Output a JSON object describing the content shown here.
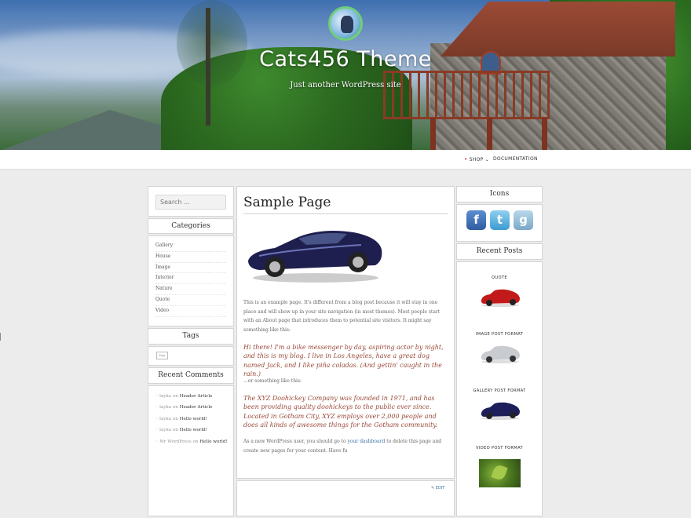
{
  "site": {
    "title": "Cats456 Theme",
    "tagline": "Just another WordPress site"
  },
  "nav": {
    "items": [
      {
        "label": "SHOP",
        "has_dropdown": true
      },
      {
        "label": "DOCUMENTATION",
        "has_dropdown": false
      }
    ]
  },
  "left_sidebar": {
    "search_placeholder": "Search ...",
    "categories_title": "Categories",
    "categories": [
      "Gallery",
      "House",
      "Image",
      "Interior",
      "Nature",
      "Quote",
      "Video"
    ],
    "tags_title": "Tags",
    "tag_chip": "Tags",
    "recent_comments_title": "Recent Comments",
    "comments": [
      {
        "author": "layka",
        "on": "on",
        "target": "Header Article"
      },
      {
        "author": "layka",
        "on": "on",
        "target": "Header Article"
      },
      {
        "author": "layka",
        "on": "on",
        "target": "Hello world!"
      },
      {
        "author": "layka",
        "on": "on",
        "target": "Hello world!"
      },
      {
        "author": "Mr WordPress",
        "on": "on",
        "target": "Hello world!"
      }
    ]
  },
  "main": {
    "page_title": "Sample Page",
    "para1": "This is an example page. It's different from a blog post because it will stay in one place and will show up in your site navigation (in most themes). Most people start with an About page that introduces them to potential site visitors. It might say something like this:",
    "quote1": "Hi there! I'm a bike messenger by day, aspiring actor by night, and this is my blog. I live in Los Angeles, have a great dog named Jack, and I like piña coladas. (And gettin' caught in the rain.)",
    "para2": "...or something like this:",
    "quote2": "The XYZ Doohickey Company was founded in 1971, and has been providing quality doohickeys to the public ever since. Located in Gotham City, XYZ employs over 2,000 people and does all kinds of awesome things for the Gotham community.",
    "para3_before": "As a new WordPress user, you should go to ",
    "para3_link": "your dashboard",
    "para3_after": " to delete this page and create new pages for your content. Have fu",
    "edit_label": "EDIT"
  },
  "right_sidebar": {
    "icons_title": "Icons",
    "social": [
      {
        "name": "facebook",
        "glyph": "f",
        "color": "#3b5998"
      },
      {
        "name": "twitter",
        "glyph": "t",
        "color": "#55acee"
      },
      {
        "name": "google",
        "glyph": "g",
        "color": "#8fb6d2"
      }
    ],
    "recent_posts_title": "Recent Posts",
    "posts": [
      {
        "label": "QUOTE",
        "thumb": "red-car"
      },
      {
        "label": "IMAGE POST FORMAT",
        "thumb": "silver-car"
      },
      {
        "label": "GALLERY POST FORMAT",
        "thumb": "blue-car"
      },
      {
        "label": "VIDEO POST FORMAT",
        "thumb": "leaf"
      }
    ]
  },
  "colors": {
    "quote_text": "#9b4a3a",
    "link": "#3b6fa5",
    "nav_dot": "#cc3333",
    "background": "#ececec"
  }
}
